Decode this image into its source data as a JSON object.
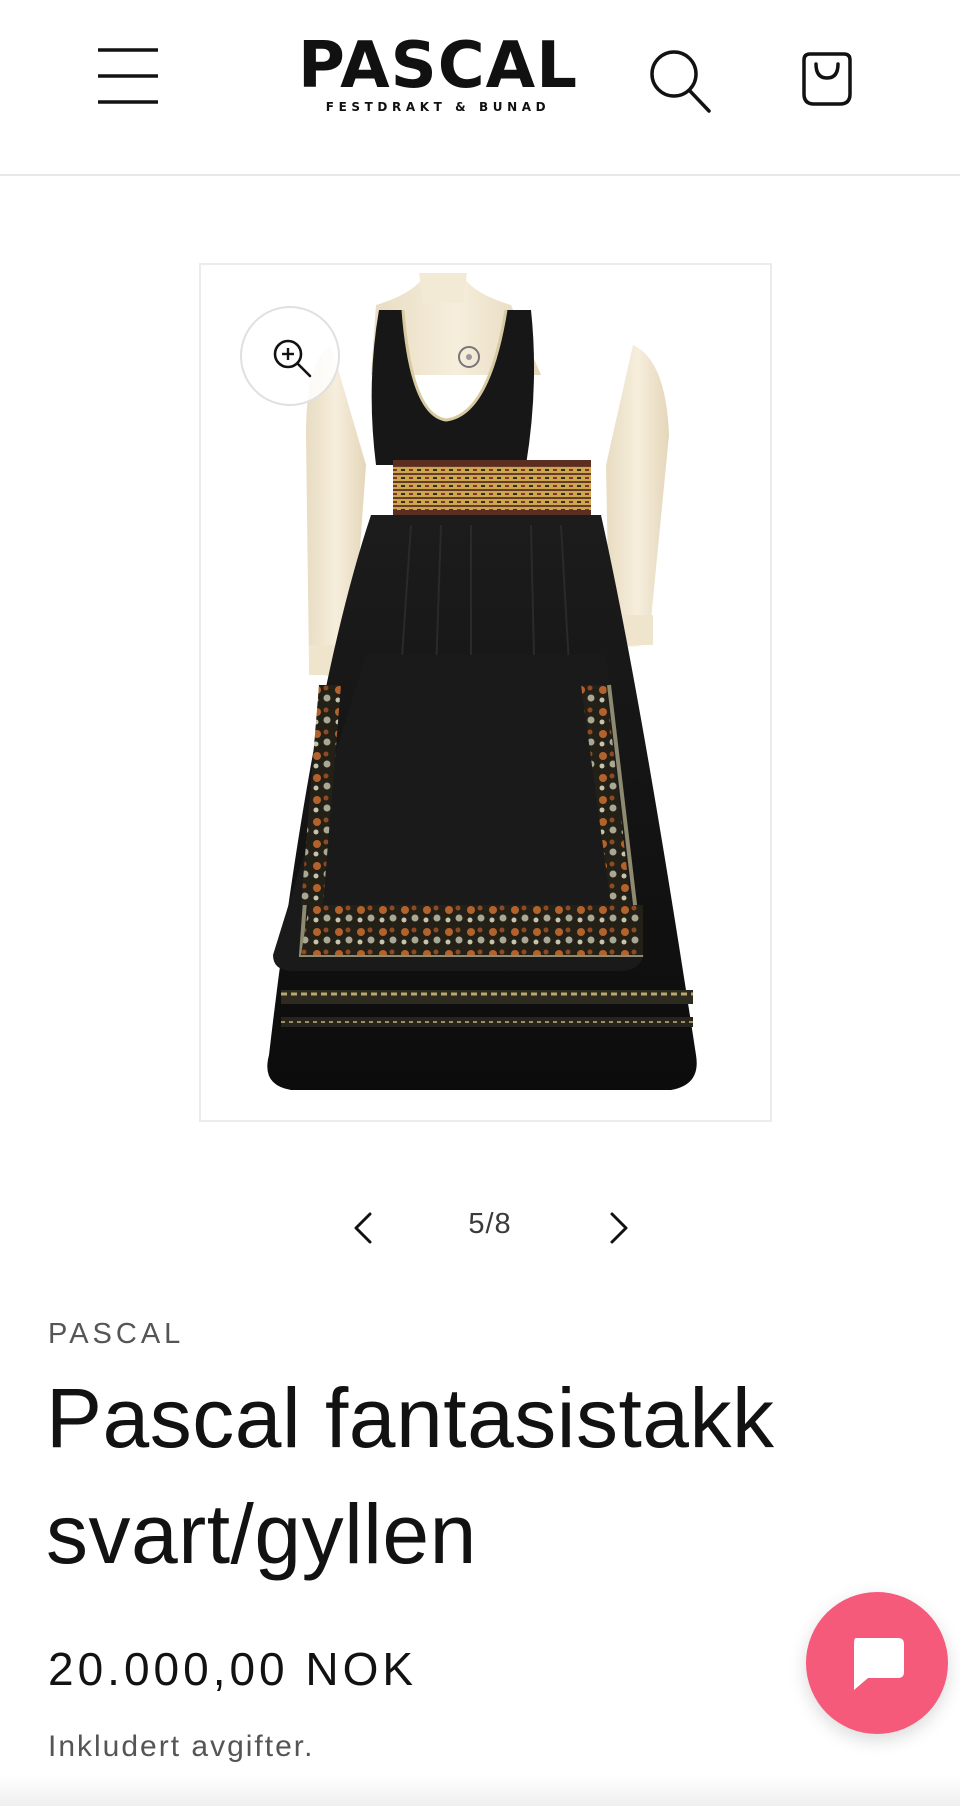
{
  "header": {
    "logo_main": "PASCAL",
    "logo_sub": "FESTDRAKT & BUNAD",
    "icons": {
      "menu": "hamburger-menu-icon",
      "search": "search-icon",
      "cart": "shopping-bag-icon"
    }
  },
  "gallery": {
    "image_alt": "Pascal fantasistakk svart/gyllen",
    "counter": "5/8",
    "icons": {
      "zoom": "zoom-in-icon",
      "prev": "chevron-left-icon",
      "next": "chevron-right-icon"
    }
  },
  "product": {
    "vendor": "PASCAL",
    "title_line1": "Pascal fantasistakk",
    "title_line2": "svart/gyllen",
    "price": "20.000,00 NOK",
    "tax_note": "Inkludert avgifter."
  },
  "chat": {
    "icon": "chat-bubble-icon"
  },
  "colors": {
    "accent_chat": "#f65a7b",
    "text": "#121212",
    "muted": "#555555",
    "border": "#e8e8e8"
  }
}
